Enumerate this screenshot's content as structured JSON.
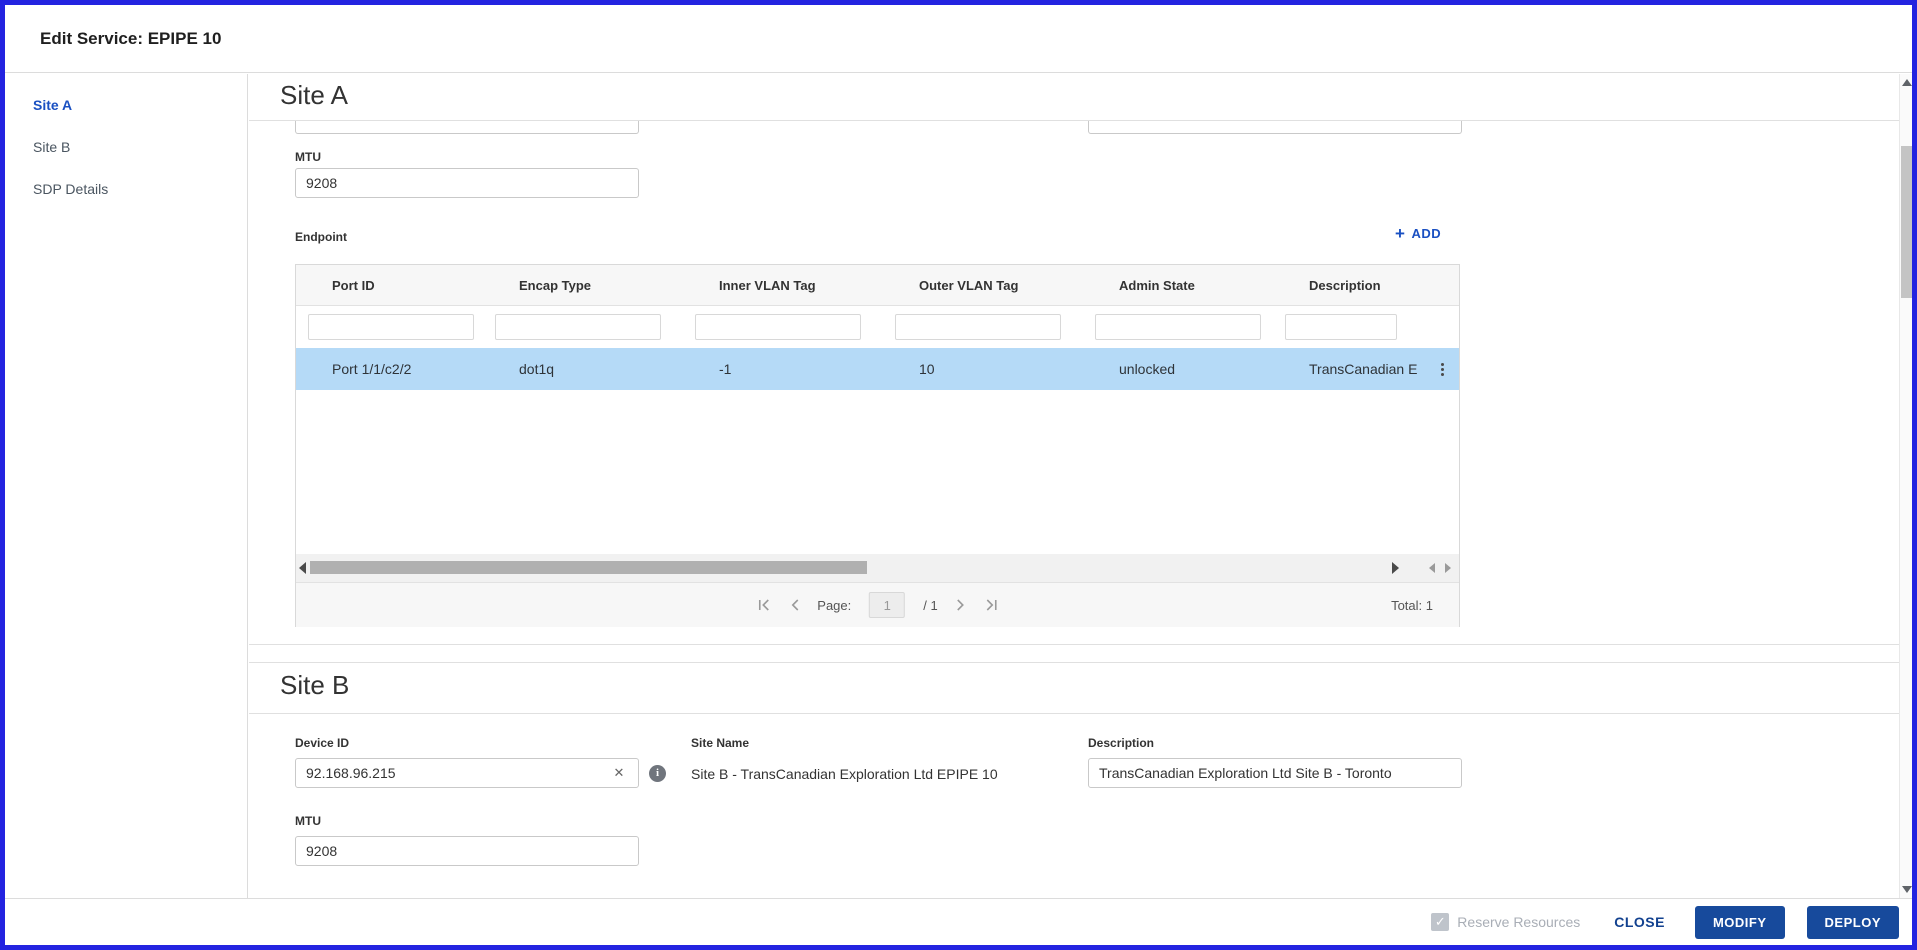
{
  "dialog": {
    "title": "Edit Service: EPIPE 10"
  },
  "sidebar": {
    "items": [
      {
        "label": "Site A",
        "active": true
      },
      {
        "label": "Site B",
        "active": false
      },
      {
        "label": "SDP Details",
        "active": false
      }
    ]
  },
  "site_a": {
    "heading": "Site A",
    "mtu": {
      "label": "MTU",
      "value": "9208"
    },
    "endpoint": {
      "label": "Endpoint",
      "add_button": "ADD",
      "columns": [
        "Port ID",
        "Encap Type",
        "Inner VLAN Tag",
        "Outer VLAN Tag",
        "Admin State",
        "Description"
      ],
      "row": {
        "port_id": "Port 1/1/c2/2",
        "encap_type": "dot1q",
        "inner_vlan_tag": "-1",
        "outer_vlan_tag": "10",
        "admin_state": "unlocked",
        "description": "TransCanadian E"
      },
      "pagination": {
        "page_label": "Page:",
        "current_page": "1",
        "of_pages": "/ 1",
        "total": "Total: 1"
      }
    }
  },
  "site_b": {
    "heading": "Site B",
    "device_id": {
      "label": "Device ID",
      "value": "92.168.96.215"
    },
    "site_name": {
      "label": "Site Name",
      "value": "Site B - TransCanadian Exploration Ltd EPIPE 10"
    },
    "description": {
      "label": "Description",
      "value": "TransCanadian Exploration Ltd Site B - Toronto"
    },
    "mtu": {
      "label": "MTU",
      "value": "9208"
    }
  },
  "footer": {
    "reserve_resources_label": "Reserve Resources",
    "reserve_resources_checked": "✓",
    "close": "CLOSE",
    "modify": "MODIFY",
    "deploy": "DEPLOY"
  },
  "colors": {
    "window_border": "#2323e0",
    "accent_blue": "#1a50c2",
    "button_navy": "#174a9c",
    "selected_row": "#b5daf7",
    "divider": "#dcdcdc"
  }
}
